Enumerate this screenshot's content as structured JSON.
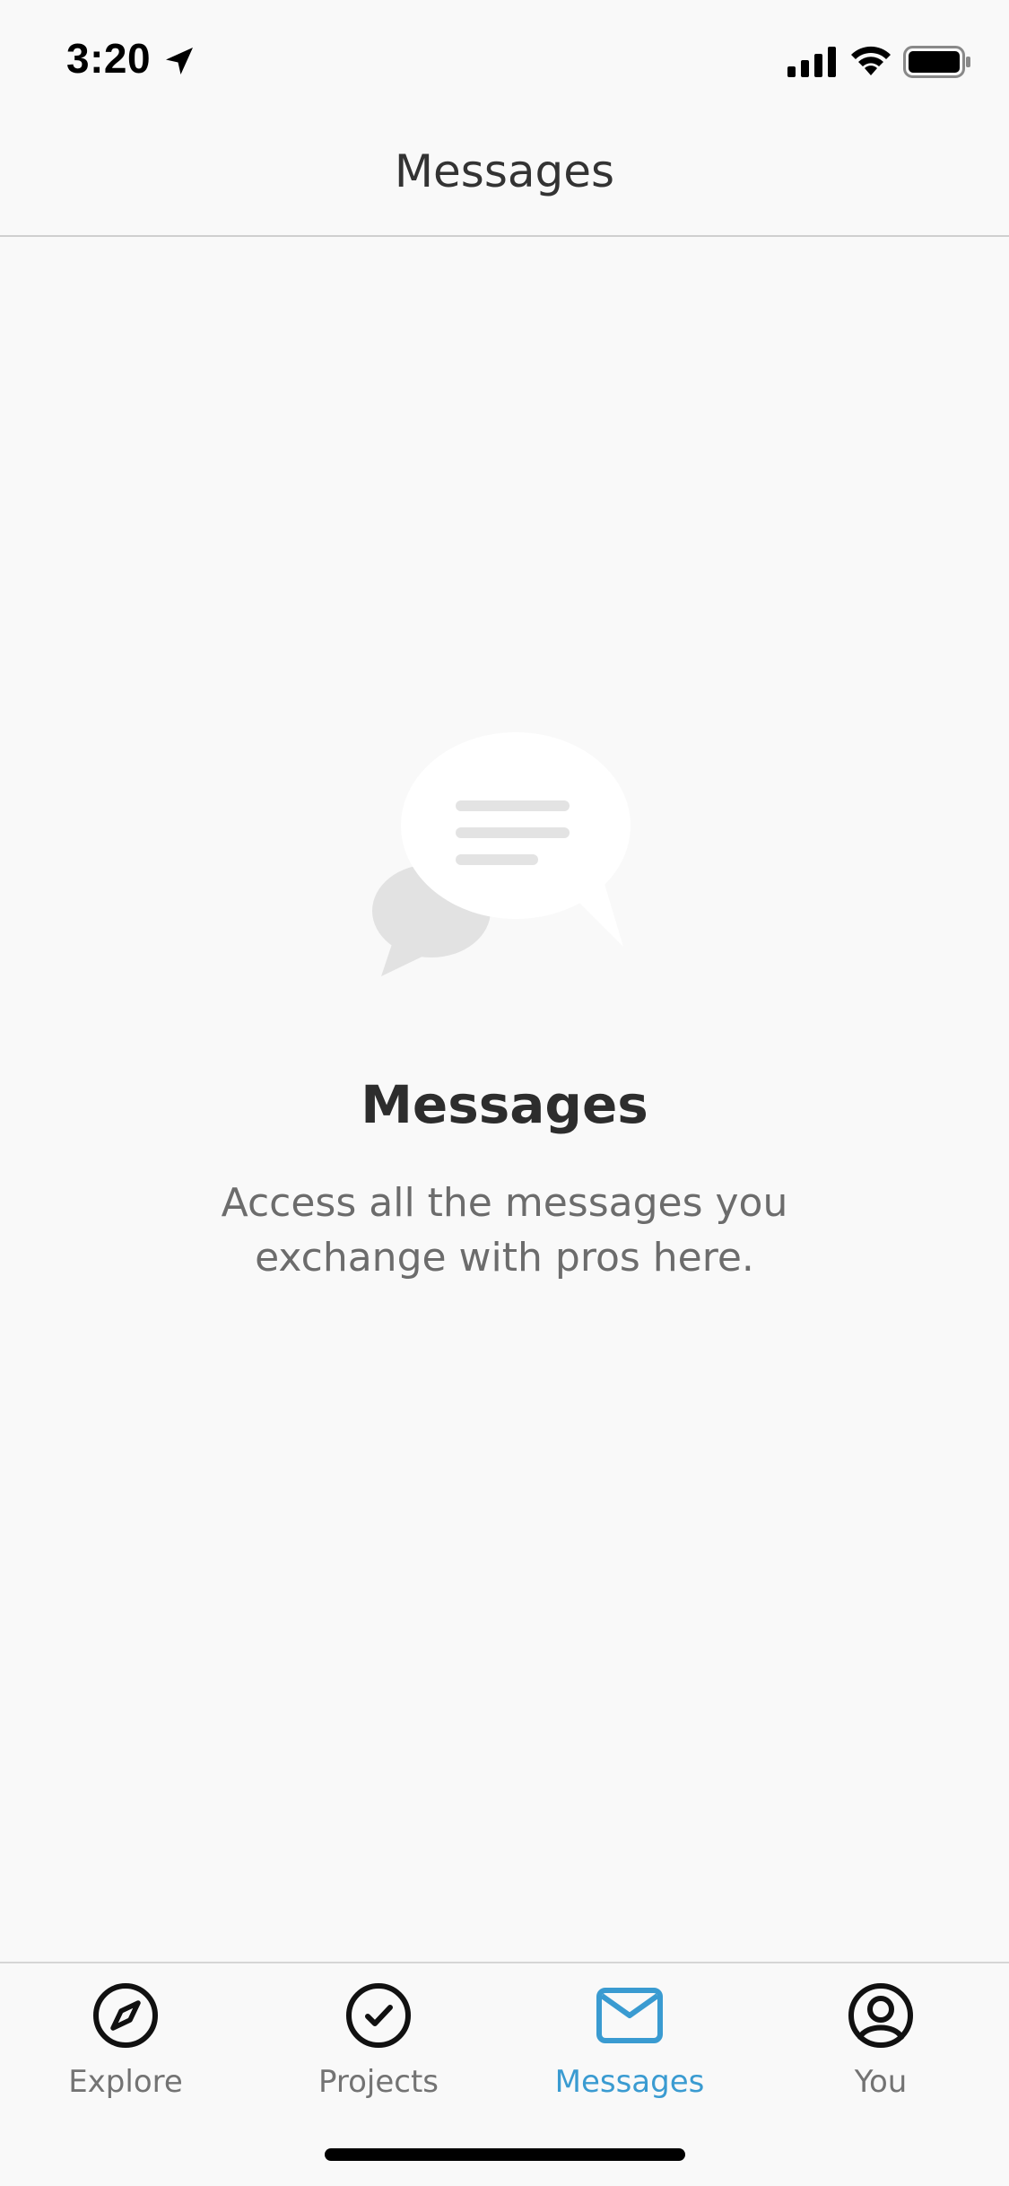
{
  "status_bar": {
    "time": "3:20"
  },
  "header": {
    "title": "Messages"
  },
  "empty_state": {
    "title": "Messages",
    "description": "Access all the messages you exchange with pros here."
  },
  "tab_bar": {
    "tabs": [
      {
        "label": "Explore",
        "icon": "compass-icon",
        "active": false
      },
      {
        "label": "Projects",
        "icon": "check-circle-icon",
        "active": false
      },
      {
        "label": "Messages",
        "icon": "envelope-icon",
        "active": true
      },
      {
        "label": "You",
        "icon": "user-circle-icon",
        "active": false
      }
    ]
  },
  "colors": {
    "accent": "#3a9bd1",
    "inactive": "#737373",
    "background": "#f9f9f9"
  }
}
